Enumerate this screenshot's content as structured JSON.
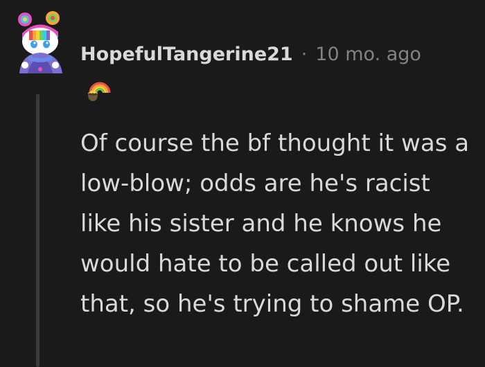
{
  "comment": {
    "username": "HopefulTangerine21",
    "separator": "·",
    "age": "10 mo. ago",
    "body": "Of course the bf thought it was a low-blow; odds are he's racist like his sister and he knows he would hate to be called out like that, so he's trying to shame OP.",
    "avatar_icon": "snoo-avatar-icon",
    "flair_icon": "rainbow-pot-of-gold-icon"
  },
  "colors": {
    "background": "#1a1a1b",
    "text": "#d7dadc",
    "meta": "#818384",
    "thread_line": "#3a3a3c"
  }
}
